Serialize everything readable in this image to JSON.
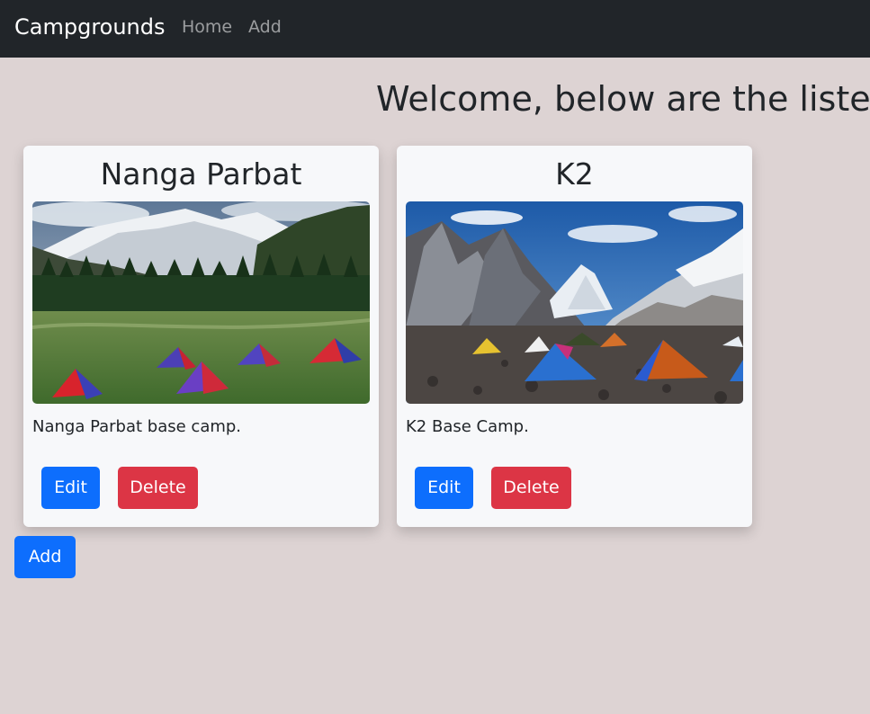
{
  "navbar": {
    "brand": "Campgrounds",
    "links": [
      {
        "label": "Home"
      },
      {
        "label": "Add"
      }
    ]
  },
  "main": {
    "heading": "Welcome, below are the listed"
  },
  "campgrounds": [
    {
      "title": "Nanga Parbat",
      "description": "Nanga Parbat base camp.",
      "image_alt": "Tents on a green meadow below Nanga Parbat",
      "edit_label": "Edit",
      "delete_label": "Delete"
    },
    {
      "title": "K2",
      "description": "K2 Base Camp.",
      "image_alt": "Tents on a rocky glacier below K2",
      "edit_label": "Edit",
      "delete_label": "Delete"
    }
  ],
  "add_button": "Add",
  "colors": {
    "navbar": "#212529",
    "page_background": "#ddd3d3",
    "card_background": "#f7f8fa",
    "primary": "#0d6efd",
    "danger": "#dc3545"
  }
}
